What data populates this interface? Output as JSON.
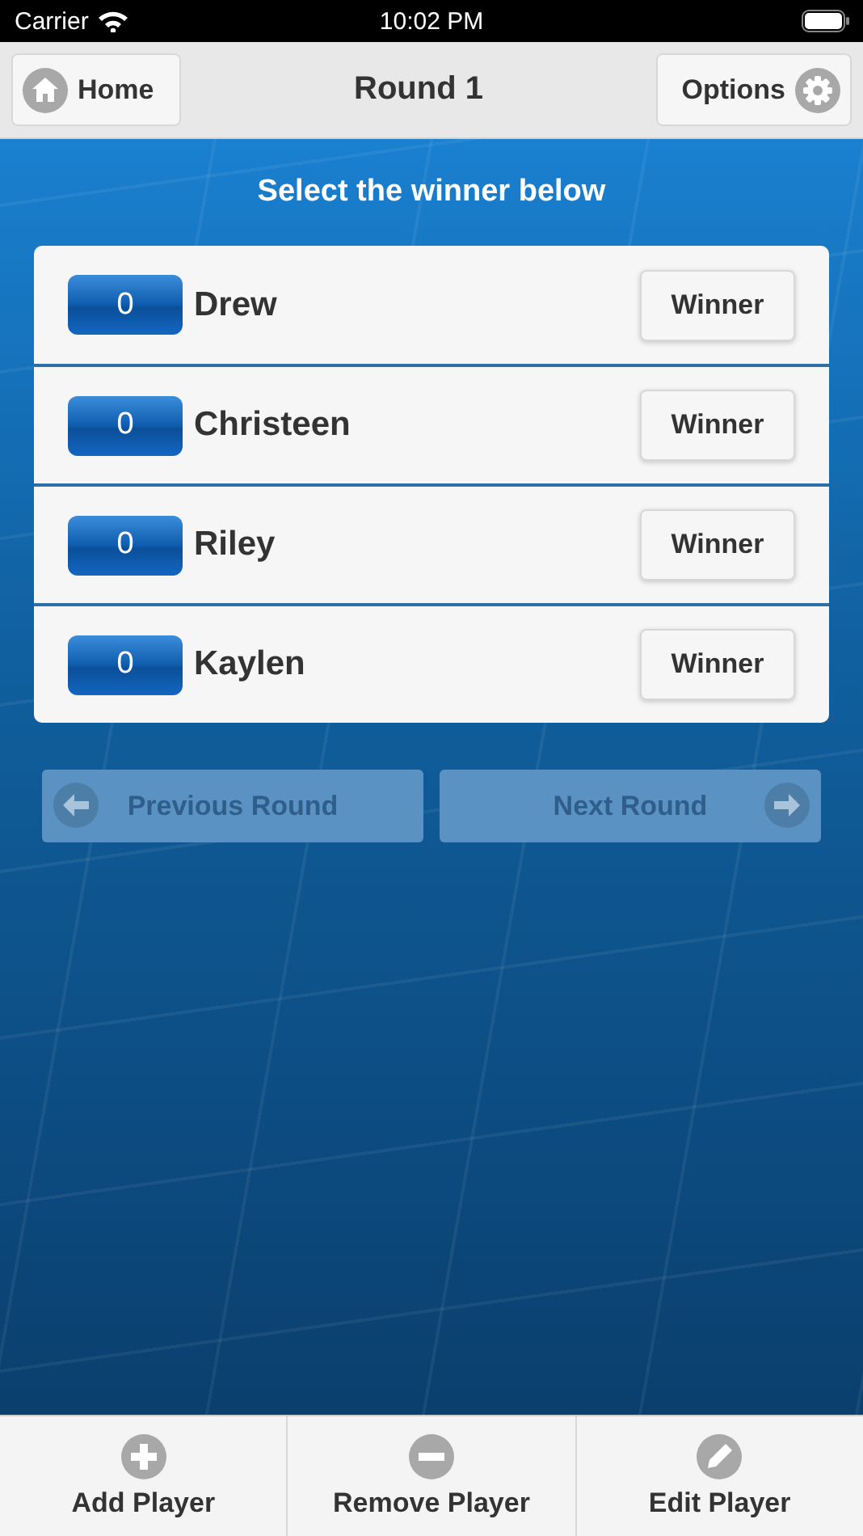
{
  "status_bar": {
    "carrier": "Carrier",
    "time": "10:02 PM"
  },
  "header": {
    "title": "Round 1",
    "left_button": {
      "label": "Home"
    },
    "right_button": {
      "label": "Options"
    }
  },
  "instruction": "Select the winner below",
  "players": [
    {
      "score": "0",
      "name": "Drew",
      "button": "Winner"
    },
    {
      "score": "0",
      "name": "Christeen",
      "button": "Winner"
    },
    {
      "score": "0",
      "name": "Riley",
      "button": "Winner"
    },
    {
      "score": "0",
      "name": "Kaylen",
      "button": "Winner"
    }
  ],
  "nav": [
    {
      "kind": "previous",
      "label": "Previous Round",
      "disabled": true
    },
    {
      "kind": "next",
      "label": "Next Round",
      "disabled": true
    }
  ],
  "toolbar": [
    {
      "kind": "add",
      "label": "Add Player"
    },
    {
      "kind": "remove",
      "label": "Remove Player"
    },
    {
      "kind": "edit",
      "label": "Edit Player"
    }
  ]
}
